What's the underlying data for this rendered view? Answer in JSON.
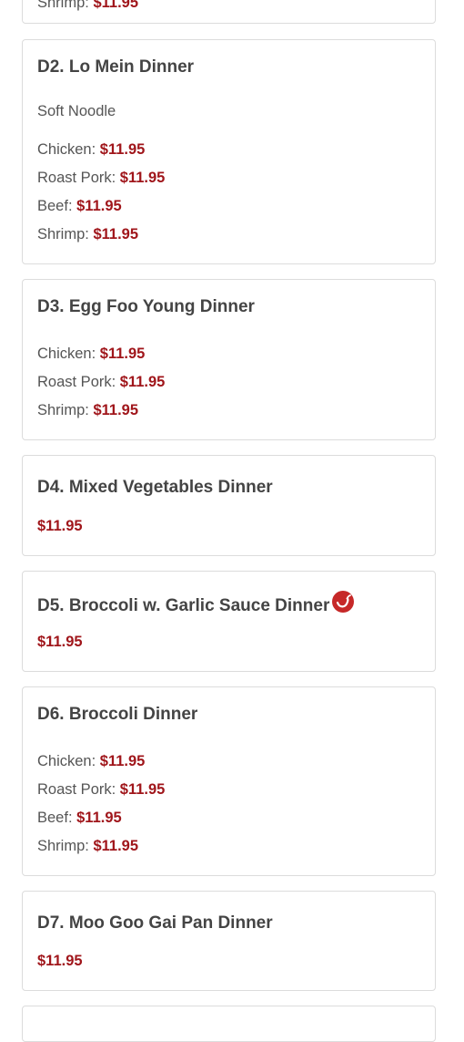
{
  "top_partial": {
    "label": "Shrimp:",
    "price": "$11.95"
  },
  "items": [
    {
      "title": "D2. Lo Mein Dinner",
      "description": "Soft Noodle",
      "options": [
        {
          "label": "Chicken:",
          "price": "$11.95"
        },
        {
          "label": "Roast Pork:",
          "price": "$11.95"
        },
        {
          "label": "Beef:",
          "price": "$11.95"
        },
        {
          "label": "Shrimp:",
          "price": "$11.95"
        }
      ]
    },
    {
      "title": "D3. Egg Foo Young Dinner",
      "options": [
        {
          "label": "Chicken:",
          "price": "$11.95"
        },
        {
          "label": "Roast Pork:",
          "price": "$11.95"
        },
        {
          "label": "Shrimp:",
          "price": "$11.95"
        }
      ]
    },
    {
      "title": "D4. Mixed Vegetables Dinner",
      "price": "$11.95"
    },
    {
      "title": "D5. Broccoli w. Garlic Sauce Dinner",
      "price": "$11.95",
      "icon": "spicy-icon"
    },
    {
      "title": "D6. Broccoli Dinner",
      "options": [
        {
          "label": "Chicken:",
          "price": "$11.95"
        },
        {
          "label": "Roast Pork:",
          "price": "$11.95"
        },
        {
          "label": "Beef:",
          "price": "$11.95"
        },
        {
          "label": "Shrimp:",
          "price": "$11.95"
        }
      ]
    },
    {
      "title": "D7. Moo Goo Gai Pan Dinner",
      "price": "$11.95"
    }
  ],
  "colors": {
    "price": "#a0161b",
    "spicy": "#c62828",
    "border": "#dcdcdc"
  }
}
